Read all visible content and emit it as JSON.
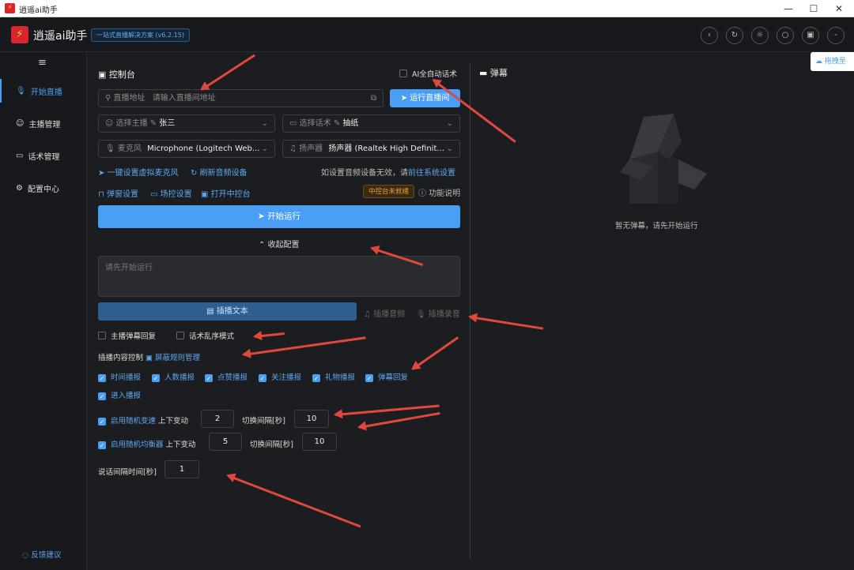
{
  "window": {
    "title": "逍遥ai助手",
    "min": "—",
    "max": "☐",
    "close": "✕"
  },
  "header": {
    "app_name": "逍遥ai助手",
    "version_badge": "一站式直播解决方案 (v6.2.15)"
  },
  "sidebar": {
    "menu_icon": "≡",
    "items": [
      {
        "label": "开始直播",
        "icon": "mic-icon"
      },
      {
        "label": "主播管理",
        "icon": "user-icon"
      },
      {
        "label": "话术管理",
        "icon": "chat-icon"
      },
      {
        "label": "配置中心",
        "icon": "gear-icon"
      }
    ],
    "feedback": "反馈建议"
  },
  "console": {
    "title": "控制台",
    "ai_auto_label": "AI全自动话术",
    "url_prefix": "直播地址",
    "url_placeholder": "请输入直播间地址",
    "run_room_btn": "运行直播间",
    "host_select_label": "选择主播",
    "host_value": "张三",
    "script_select_label": "选择话术",
    "script_value": "抽纸",
    "mic_label": "麦克风",
    "mic_value": "Microphone (Logitech Web...",
    "speaker_label": "扬声器",
    "speaker_value": "扬声器 (Realtek High Definit...",
    "virtual_mic_link": "一键设置虚拟麦克风",
    "refresh_audio_link": "刷新音频设备",
    "audio_hint": "如设置音频设备无效，请",
    "system_settings_link": "前往系统设置",
    "barrage_settings": "弹窗设置",
    "scene_settings": "场控设置",
    "open_console": "打开中控台",
    "status_badge": "中控台未就绪",
    "help_label": "功能说明",
    "start_btn": "开始运行",
    "collapse_label": "收起配置",
    "textarea_placeholder": "请先开始运行",
    "insert_text_btn": "插播文本",
    "insert_audio_btn": "插播音频",
    "insert_record_btn": "插播录音",
    "host_reply": "主播弹幕回复",
    "script_shuffle": "话术乱序模式",
    "insert_control_label": "插播内容控制",
    "block_rules_link": "屏蔽规则管理",
    "broadcast_options": [
      "时间播报",
      "人数播报",
      "点赞播报",
      "关注播报",
      "礼物播报",
      "弹幕回复",
      "进入播报"
    ],
    "random_speed_label": "启用随机变速",
    "random_vol_label": "启用随机均衡器",
    "range_label": "上下变动",
    "interval_label": "切换间隔[秒]",
    "speed_range": "2",
    "speed_interval": "10",
    "vol_range": "5",
    "vol_interval": "10",
    "speak_interval_label": "说话间隔时间[秒]",
    "speak_interval": "1"
  },
  "barrage": {
    "title": "弹幕",
    "empty_text": "暂无弹幕，请先开始运行",
    "floating_tab": "拖拽至"
  }
}
